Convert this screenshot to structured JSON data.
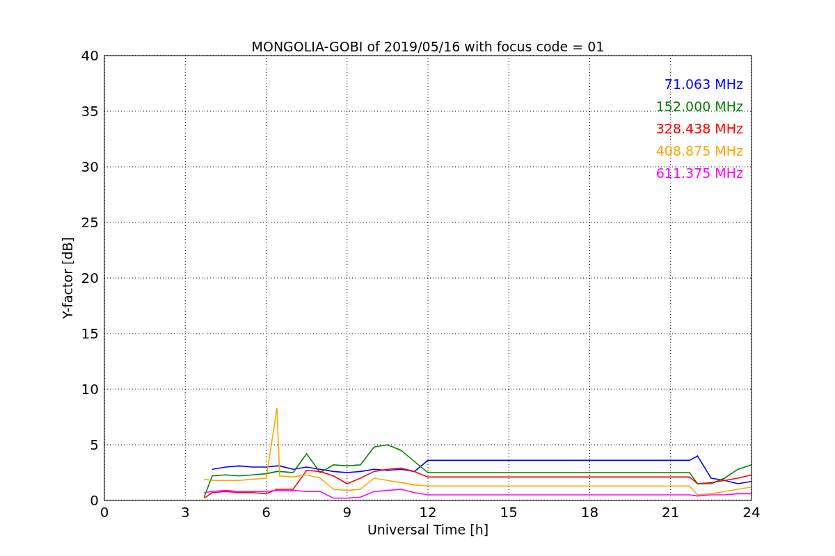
{
  "chart_data": {
    "type": "line",
    "title": "MONGOLIA-GOBI of 2019/05/16 with focus code = 01",
    "xlabel": "Universal Time [h]",
    "ylabel": "Y-factor [dB]",
    "x": [
      3.7,
      4,
      4.5,
      5,
      5.5,
      6,
      6.4,
      6.5,
      7,
      7.5,
      8,
      8.5,
      9,
      9.5,
      10,
      10.5,
      11,
      11.5,
      12,
      21.7,
      22,
      22.5,
      23,
      23.5,
      24
    ],
    "series": [
      {
        "name": "71.063 MHz",
        "color": "#0000ff",
        "values": [
          null,
          2.8,
          3,
          3.1,
          3,
          3,
          3.1,
          3.1,
          2.8,
          3,
          2.8,
          2.6,
          2.5,
          2.6,
          2.8,
          2.7,
          2.8,
          2.6,
          3.6,
          3.6,
          4,
          2,
          1.8,
          1.5,
          1.7
        ]
      },
      {
        "name": "152.000 MHz",
        "color": "#008000",
        "values": [
          0.3,
          2.2,
          2.3,
          2.2,
          2.3,
          2.4,
          2.6,
          2.6,
          2.5,
          4.2,
          2.5,
          3.2,
          3.1,
          3.2,
          4.8,
          5,
          4.5,
          3.5,
          2.5,
          2.5,
          1.5,
          1.5,
          2,
          2.8,
          3.2
        ]
      },
      {
        "name": "328.438 MHz",
        "color": "#ff0000",
        "values": [
          0.2,
          0.7,
          0.8,
          0.7,
          0.7,
          0.6,
          1,
          1,
          1,
          2.7,
          2.6,
          2.2,
          1.5,
          2,
          2.6,
          2.8,
          2.9,
          2.6,
          2.1,
          2.1,
          1.5,
          1.6,
          1.8,
          2,
          2.3
        ]
      },
      {
        "name": "408.875 MHz",
        "color": "#ffa500",
        "values": [
          1.9,
          1.8,
          1.8,
          1.8,
          1.9,
          2,
          8.3,
          2.2,
          2.1,
          2.3,
          2,
          1,
          0.9,
          1,
          2,
          1.8,
          1.6,
          1.4,
          1.3,
          1.3,
          0.5,
          0.6,
          0.8,
          1,
          1.2
        ]
      },
      {
        "name": "611.375 MHz",
        "color": "#ff00ff",
        "values": [
          0.7,
          0.8,
          0.9,
          0.8,
          0.8,
          0.8,
          0.9,
          0.9,
          0.9,
          0.8,
          0.8,
          0.2,
          0.2,
          0.3,
          0.8,
          0.9,
          1,
          0.7,
          0.5,
          0.5,
          0.4,
          0.5,
          0.5,
          0.6,
          0.6
        ]
      }
    ],
    "grid": true,
    "xlim": [
      0,
      24
    ],
    "ylim": [
      0,
      40
    ],
    "xticks": [
      0,
      3,
      6,
      9,
      12,
      15,
      18,
      21,
      24
    ],
    "yticks": [
      0,
      5,
      10,
      15,
      20,
      25,
      30,
      35,
      40
    ]
  }
}
